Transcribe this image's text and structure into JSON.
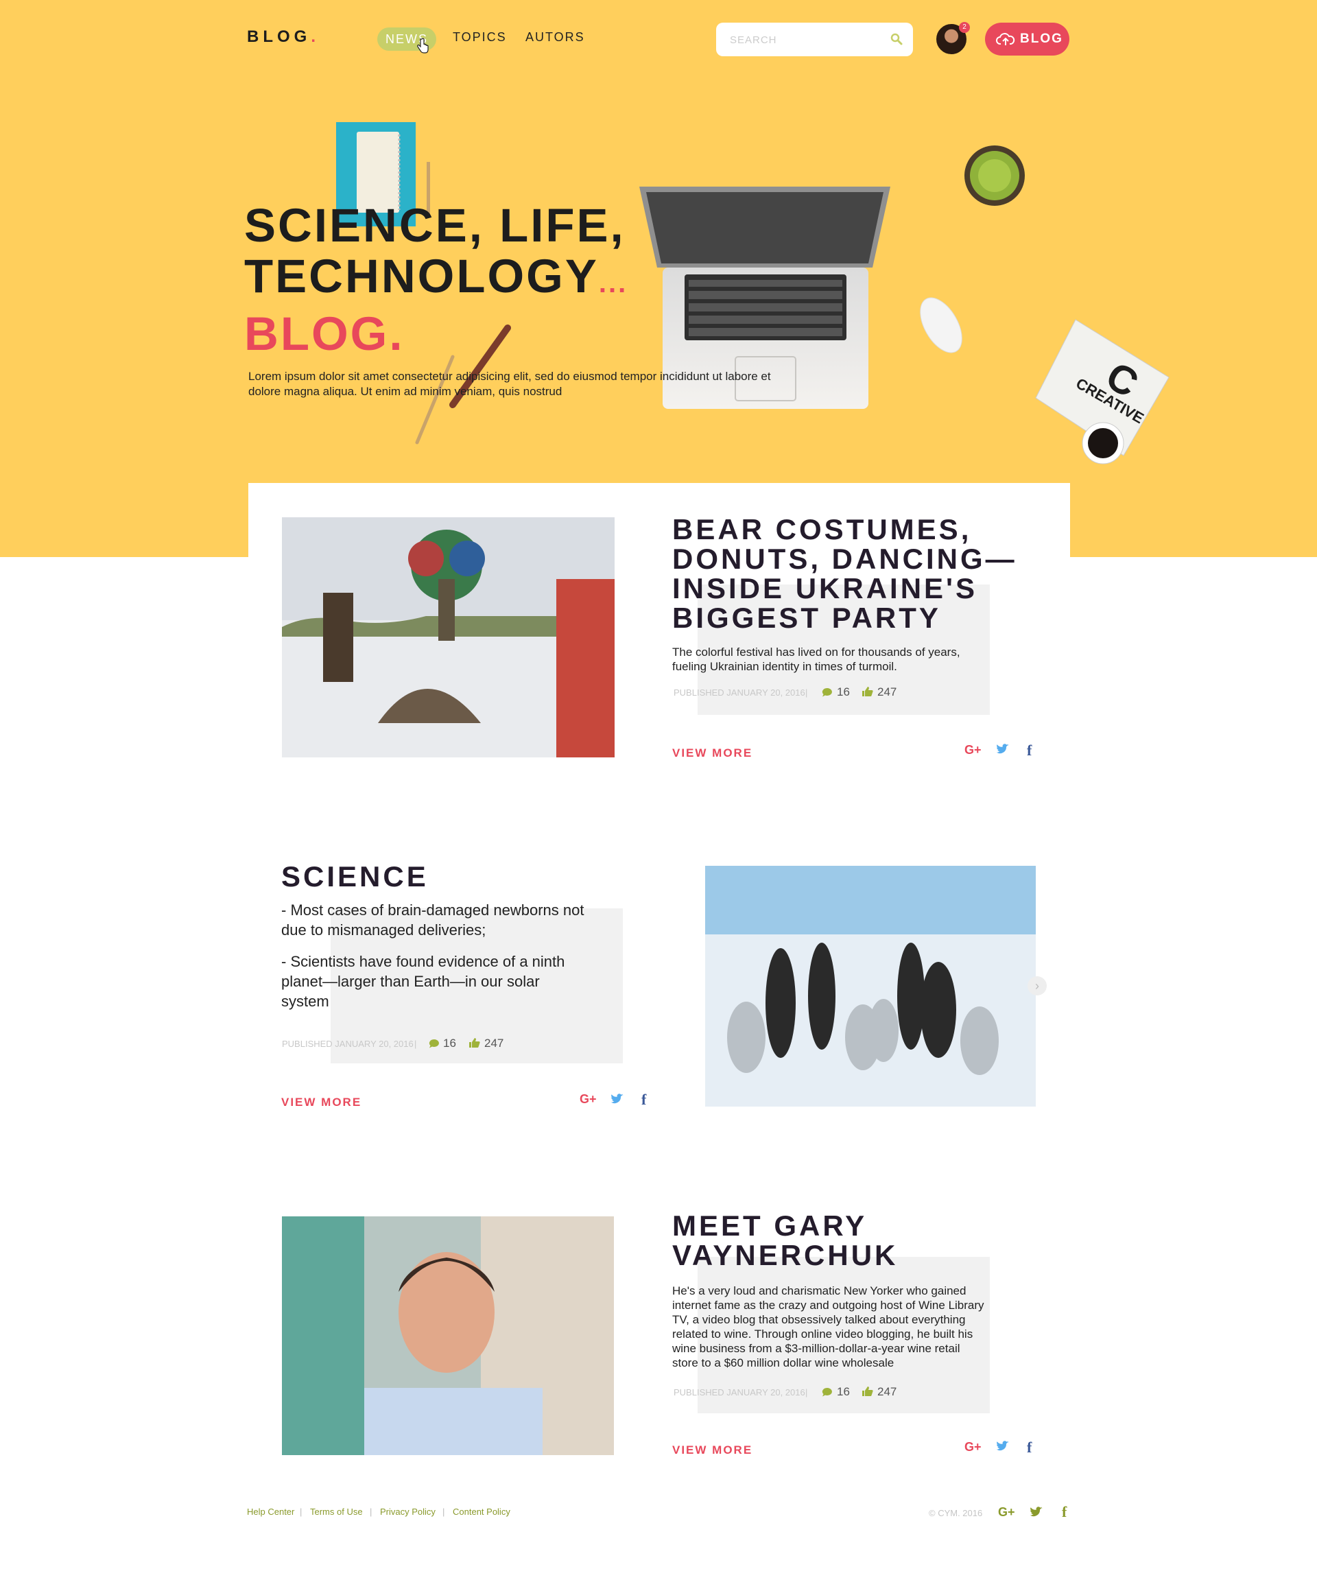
{
  "header": {
    "logo": "BLOG",
    "logo_dot": ".",
    "nav": [
      "NEWS",
      "TOPICS",
      "AUTORS"
    ],
    "search_placeholder": "SEARCH",
    "notifications": "2",
    "blog_button": "BLOG"
  },
  "hero": {
    "line1": "SCIENCE, LIFE,",
    "line2": "TECHNOLOGY",
    "line2_ellipsis": "...",
    "line3": "BLOG.",
    "text": "Lorem ipsum dolor sit amet consectetur adipisicing elit, sed do eiusmod tempor incididunt ut labore et dolore magna aliqua. Ut enim ad minim veniam, quis nostrud",
    "magazine_text": "C CREATIVE MES"
  },
  "posts": [
    {
      "title": "BEAR COSTUMES, DONUTS, DANCING— INSIDE UKRAINE'S BIGGEST PARTY",
      "description": "The colorful festival has lived on for thousands of years, fueling Ukrainian identity in times of turmoil.",
      "published": "PUBLISHED JANUARY 20, 2016",
      "comments": "16",
      "likes": "247",
      "view_more": "VIEW MORE",
      "social": [
        "G+",
        "t",
        "f"
      ]
    },
    {
      "title": "SCIENCE",
      "bullets": [
        "- Most cases of brain-damaged newborns not due to mismanaged deliveries;",
        "- Scientists have found evidence of a ninth planet—larger than Earth—in our solar system"
      ],
      "published": "PUBLISHED JANUARY 20, 2016",
      "comments": "16",
      "likes": "247",
      "view_more": "VIEW MORE",
      "social": [
        "G+",
        "t",
        "f"
      ]
    },
    {
      "title": "MEET GARY VAYNERCHUK",
      "description": "He's a very loud and charismatic New Yorker who gained internet fame as the crazy and outgoing host of Wine Library TV, a video blog that obsessively talked about everything related to wine. Through online video blogging, he built his wine business from a $3-million-dollar-a-year wine retail store to a $60 million dollar wine wholesale",
      "published": "PUBLISHED JANUARY 20, 2016",
      "comments": "16",
      "likes": "247",
      "view_more": "VIEW MORE",
      "social": [
        "G+",
        "t",
        "f"
      ]
    }
  ],
  "footer": {
    "links": [
      "Help Center",
      "Terms of Use",
      "Privacy Policy",
      "Content Policy"
    ],
    "separator": "|",
    "copyright": "© CYM. 2016",
    "social": [
      "G+",
      "t",
      "f"
    ]
  },
  "colors": {
    "yellow": "#ffcf5c",
    "pink": "#e8485b",
    "olive": "#c7cf69",
    "dark": "#241c2c"
  }
}
